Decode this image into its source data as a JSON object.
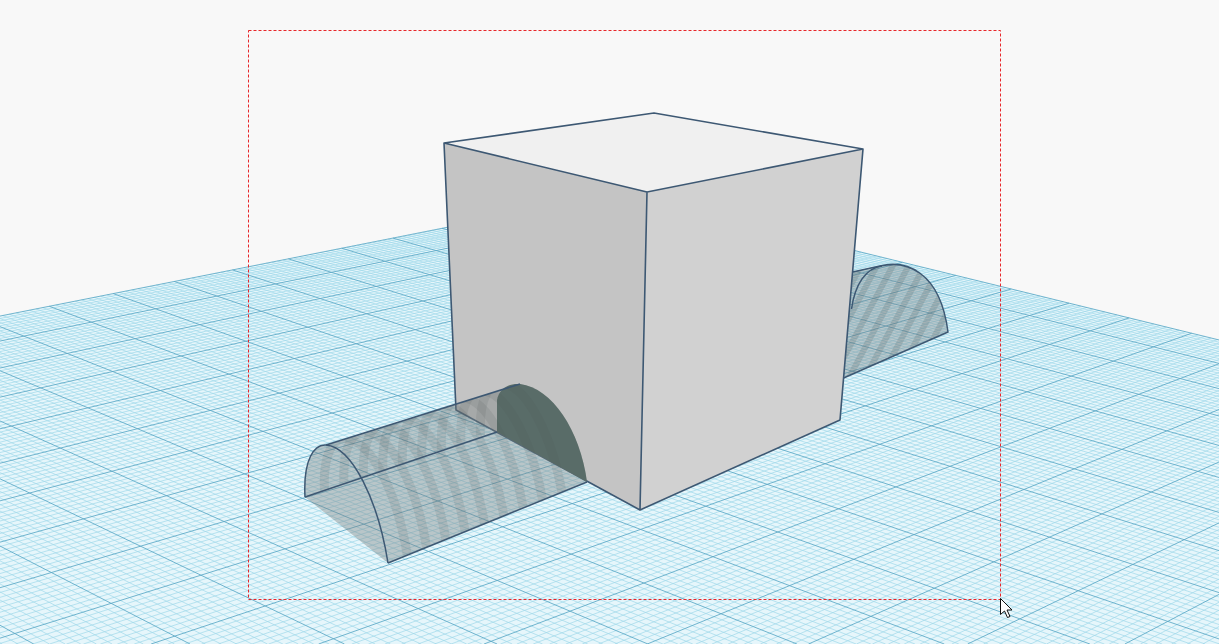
{
  "viewport": {
    "workplane": {
      "grid": true
    },
    "objects": [
      {
        "kind": "hole"
      },
      {
        "kind": "box"
      },
      {
        "kind": "hole"
      }
    ],
    "selection_marquee": true,
    "mouse_pointer": true
  }
}
